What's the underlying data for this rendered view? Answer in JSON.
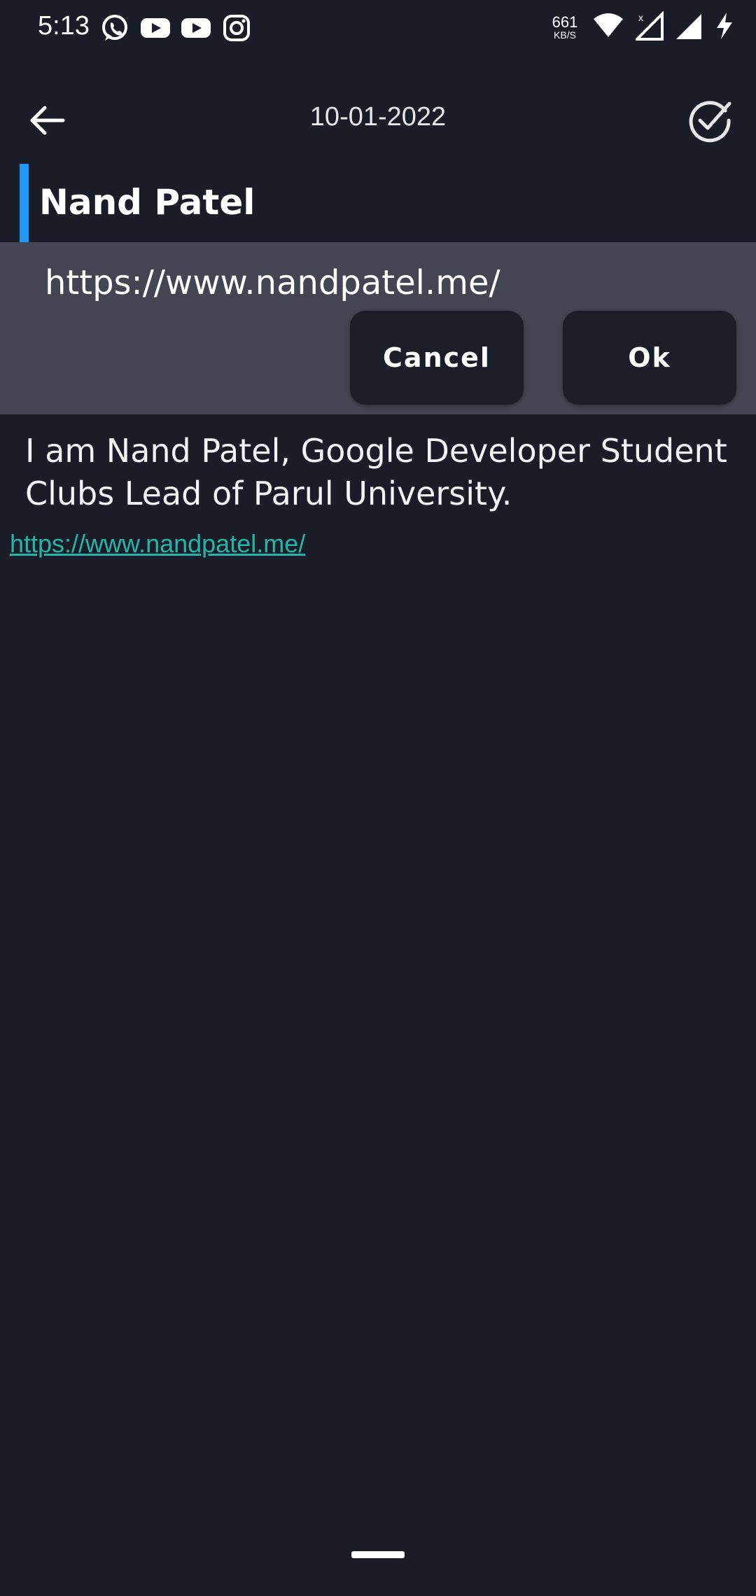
{
  "status_bar": {
    "time": "5:13",
    "notification_icons": [
      "whatsapp-icon",
      "youtube-icon",
      "youtube-icon",
      "instagram-icon"
    ],
    "net_speed_value": "661",
    "net_speed_unit": "KB/S",
    "system_icons": [
      "wifi-icon",
      "signal-icon",
      "signal-icon",
      "charging-icon"
    ]
  },
  "toolbar": {
    "date": "10-01-2022",
    "back_icon": "arrow-left-icon",
    "save_icon": "check-circle-icon"
  },
  "note": {
    "title": "Nand Patel",
    "body": "I am Nand Patel, Google Developer Student Clubs Lead of Parul University.",
    "link": "https://www.nandpatel.me/"
  },
  "link_dialog": {
    "url_value": "https://www.nandpatel.me/",
    "cancel_label": "Cancel",
    "ok_label": "Ok"
  },
  "colors": {
    "background": "#1a1d27",
    "panel": "#434652",
    "button": "#1b1e29",
    "accent": "#2196f3",
    "link": "#25b5a8"
  }
}
